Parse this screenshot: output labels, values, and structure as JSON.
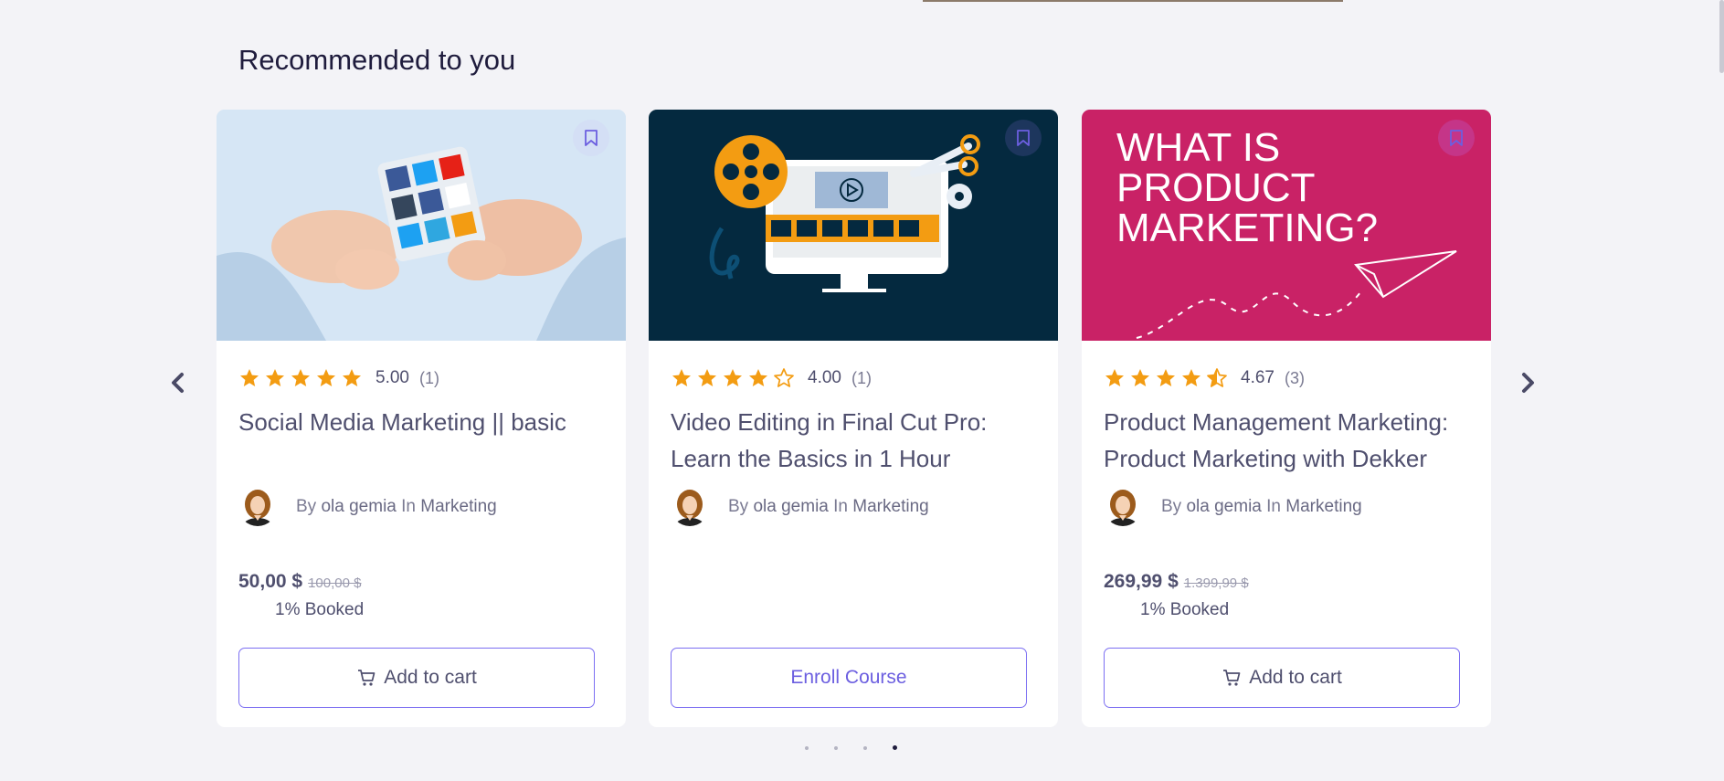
{
  "section": {
    "title": "Recommended to you"
  },
  "nav": {
    "prev_icon": "chevron-left-icon",
    "next_icon": "chevron-right-icon"
  },
  "colors": {
    "accent": "#7c6ff2",
    "star": "#f39c12",
    "text": "#4f4f6e"
  },
  "courses": [
    {
      "rating_value": "5.00",
      "rating_count": "(1)",
      "stars": 5,
      "title": "Social Media Marketing || basic",
      "author_prefix": "By",
      "author_name": "ola gemia",
      "category_prefix": "In",
      "category": "Marketing",
      "price": "50,00 $",
      "old_price": "100,00 $",
      "booked": "1% Booked",
      "button_label": "Add to cart",
      "button_icon": "cart-icon"
    },
    {
      "rating_value": "4.00",
      "rating_count": "(1)",
      "stars": 4,
      "title": "Video Editing in Final Cut Pro: Learn the Basics in 1 Hour",
      "author_prefix": "By",
      "author_name": "ola gemia",
      "category_prefix": "In",
      "category": "Marketing",
      "button_label": "Enroll Course"
    },
    {
      "rating_value": "4.67",
      "rating_count": "(3)",
      "stars": 4.5,
      "title": "Product Management Marketing: Product Marketing with Dekker",
      "thumbnail_text": [
        "WHAT IS",
        "PRODUCT",
        "MARKETING?"
      ],
      "author_prefix": "By",
      "author_name": "ola gemia",
      "category_prefix": "In",
      "category": "Marketing",
      "price": "269,99 $",
      "old_price": "1.399,99 $",
      "booked": "1% Booked",
      "button_label": "Add to cart",
      "button_icon": "cart-icon"
    }
  ],
  "pagination": {
    "total": 4,
    "active": 4
  }
}
